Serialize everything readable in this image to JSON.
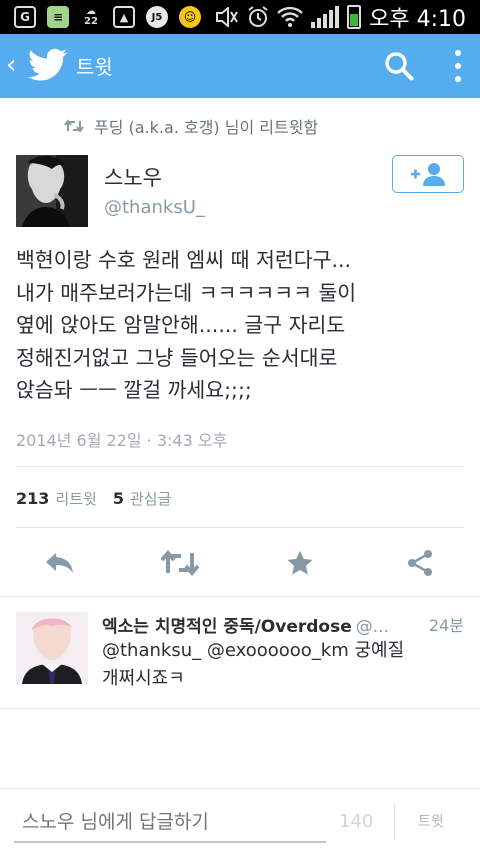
{
  "status_bar": {
    "time": "오후 4:10",
    "left_icons": [
      "g-icon",
      "doc-icon",
      "weather-icon",
      "image-icon",
      "badge-icon",
      "pororo-icon"
    ],
    "weather_text": "22",
    "badge_text": "J5"
  },
  "appbar": {
    "title": "트윗",
    "color": "#55acee"
  },
  "retweet_context": {
    "text": "푸딩 (a.k.a. 호갱) 님이 리트윗함"
  },
  "tweet": {
    "author_name": "스노우",
    "author_handle": "@thanksU_",
    "text_lines": [
      "백현이랑 수호 원래 엠씨 때 저런다구...",
      "내가 매주보러가는데 ㅋㅋㅋㅋㅋㅋ 둘이",
      "옆에 앉아도 암말안해...... 글구 자리도",
      "정해진거없고 그냥 들어오는 순서대로",
      "앉슴돠 ㅡㅡ 깔걸 까세요;;;;"
    ],
    "timestamp": "2014년 6월 22일 · 3:43 오후"
  },
  "stats": {
    "retweets_count": "213",
    "retweets_label": "리트윗",
    "favorites_count": "5",
    "favorites_label": "관심글"
  },
  "reply": {
    "name": "엑소는 치명적인 중독/Overdose",
    "handle": "@...",
    "time": "24분",
    "line1": "@thanksu_ @exoooooo_km 궁예질",
    "line2": "개쩌시죠ㅋ"
  },
  "compose": {
    "placeholder": "스노우 님에게 답글하기",
    "counter": "140",
    "button_label": "트윗"
  },
  "colors": {
    "accent": "#55acee",
    "muted": "#8899a6",
    "text": "#292f33"
  }
}
